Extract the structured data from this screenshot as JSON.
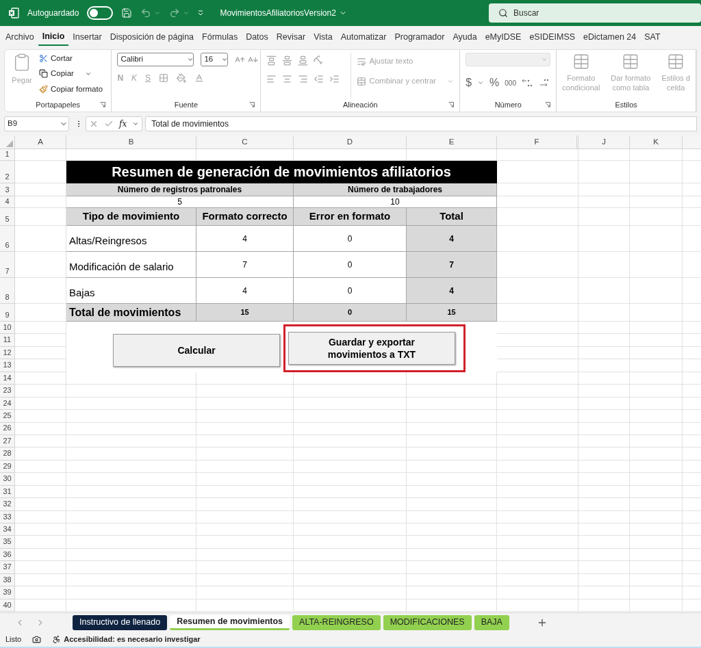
{
  "title_bar": {
    "autosave_label": "Autoguardado",
    "autosave_on": false,
    "file_name": "MovimientosAfiliatoriosVersion2",
    "search_placeholder": "Buscar"
  },
  "ribbon_tabs": [
    {
      "label": "Archivo",
      "selected": false
    },
    {
      "label": "Inicio",
      "selected": true
    },
    {
      "label": "Insertar",
      "selected": false
    },
    {
      "label": "Disposición de página",
      "selected": false
    },
    {
      "label": "Fórmulas",
      "selected": false
    },
    {
      "label": "Datos",
      "selected": false
    },
    {
      "label": "Revisar",
      "selected": false
    },
    {
      "label": "Vista",
      "selected": false
    },
    {
      "label": "Automatizar",
      "selected": false
    },
    {
      "label": "Programador",
      "selected": false
    },
    {
      "label": "Ayuda",
      "selected": false
    },
    {
      "label": "eMyIDSE",
      "selected": false
    },
    {
      "label": "eSIDEIMSS",
      "selected": false
    },
    {
      "label": "eDictamen 24",
      "selected": false
    },
    {
      "label": "SAT",
      "selected": false
    }
  ],
  "clipboard": {
    "paste": "Pegar",
    "cut": "Cortar",
    "copy": "Copiar",
    "format_painter": "Copiar formato",
    "group": "Portapapeles"
  },
  "font": {
    "name": "Calibri",
    "size": "16",
    "bold": "N",
    "italic": "K",
    "underline": "S",
    "group": "Fuente"
  },
  "alignment": {
    "wrap": "Ajustar texto",
    "merge": "Combinar y centrar",
    "group": "Alineación"
  },
  "number": {
    "currency": "$",
    "percent": "%",
    "thousands": "000",
    "group": "Número"
  },
  "styles": {
    "items": [
      [
        "Formato",
        "condicional"
      ],
      [
        "Dar formato",
        "como tabla"
      ],
      [
        "Estilos d",
        "celda"
      ]
    ],
    "group": "Estilos"
  },
  "formula_bar": {
    "name_box": "B9",
    "fx": "fx",
    "formula": "Total de movimientos"
  },
  "columns": [
    "A",
    "B",
    "C",
    "D",
    "E",
    "F",
    "J",
    "K"
  ],
  "row_numbers": [
    "1",
    "2",
    "3",
    "4",
    "5",
    "6",
    "7",
    "8",
    "9",
    "10",
    "11",
    "12",
    "13",
    "14",
    "23",
    "24",
    "25",
    "26",
    "27",
    "28",
    "29",
    "30",
    "31",
    "32",
    "33",
    "34",
    "35",
    "36",
    "37",
    "38",
    "39",
    "40"
  ],
  "summary": {
    "title": "Resumen de generación de movimientos afiliatorios",
    "labels": [
      "Número de registros patronales",
      "Número de trabajadores"
    ],
    "counts": [
      "5",
      "10"
    ],
    "headers": [
      "Tipo de movimiento",
      "Formato correcto",
      "Error en formato",
      "Total"
    ],
    "rows": [
      {
        "type": "Altas/Reingresos",
        "correct": "4",
        "error": "0",
        "total": "4"
      },
      {
        "type": "Modificación de salario",
        "correct": "7",
        "error": "0",
        "total": "7"
      },
      {
        "type": "Bajas",
        "correct": "4",
        "error": "0",
        "total": "4"
      }
    ],
    "total_row": {
      "label": "Total de movimientos",
      "correct": "15",
      "error": "0",
      "total": "15"
    }
  },
  "buttons": [
    {
      "label": "Calcular",
      "highlighted": false
    },
    {
      "label": "Guardar y exportar movimientos a TXT",
      "highlighted": true
    }
  ],
  "sheet_tabs": [
    {
      "label": "Instructivo de llenado",
      "selected": false,
      "color": "#0f2341"
    },
    {
      "label": "Resumen de movimientos",
      "selected": true,
      "color": "#92d050"
    },
    {
      "label": "ALTA-REINGRESO",
      "selected": false,
      "color": "#92d050"
    },
    {
      "label": "MODIFICACIONES",
      "selected": false,
      "color": "#92d050"
    },
    {
      "label": "BAJA",
      "selected": false,
      "color": "#92d050"
    }
  ],
  "status_bar": {
    "ready": "Listo",
    "accessibility": "Accesibilidad: es necesario investigar"
  }
}
